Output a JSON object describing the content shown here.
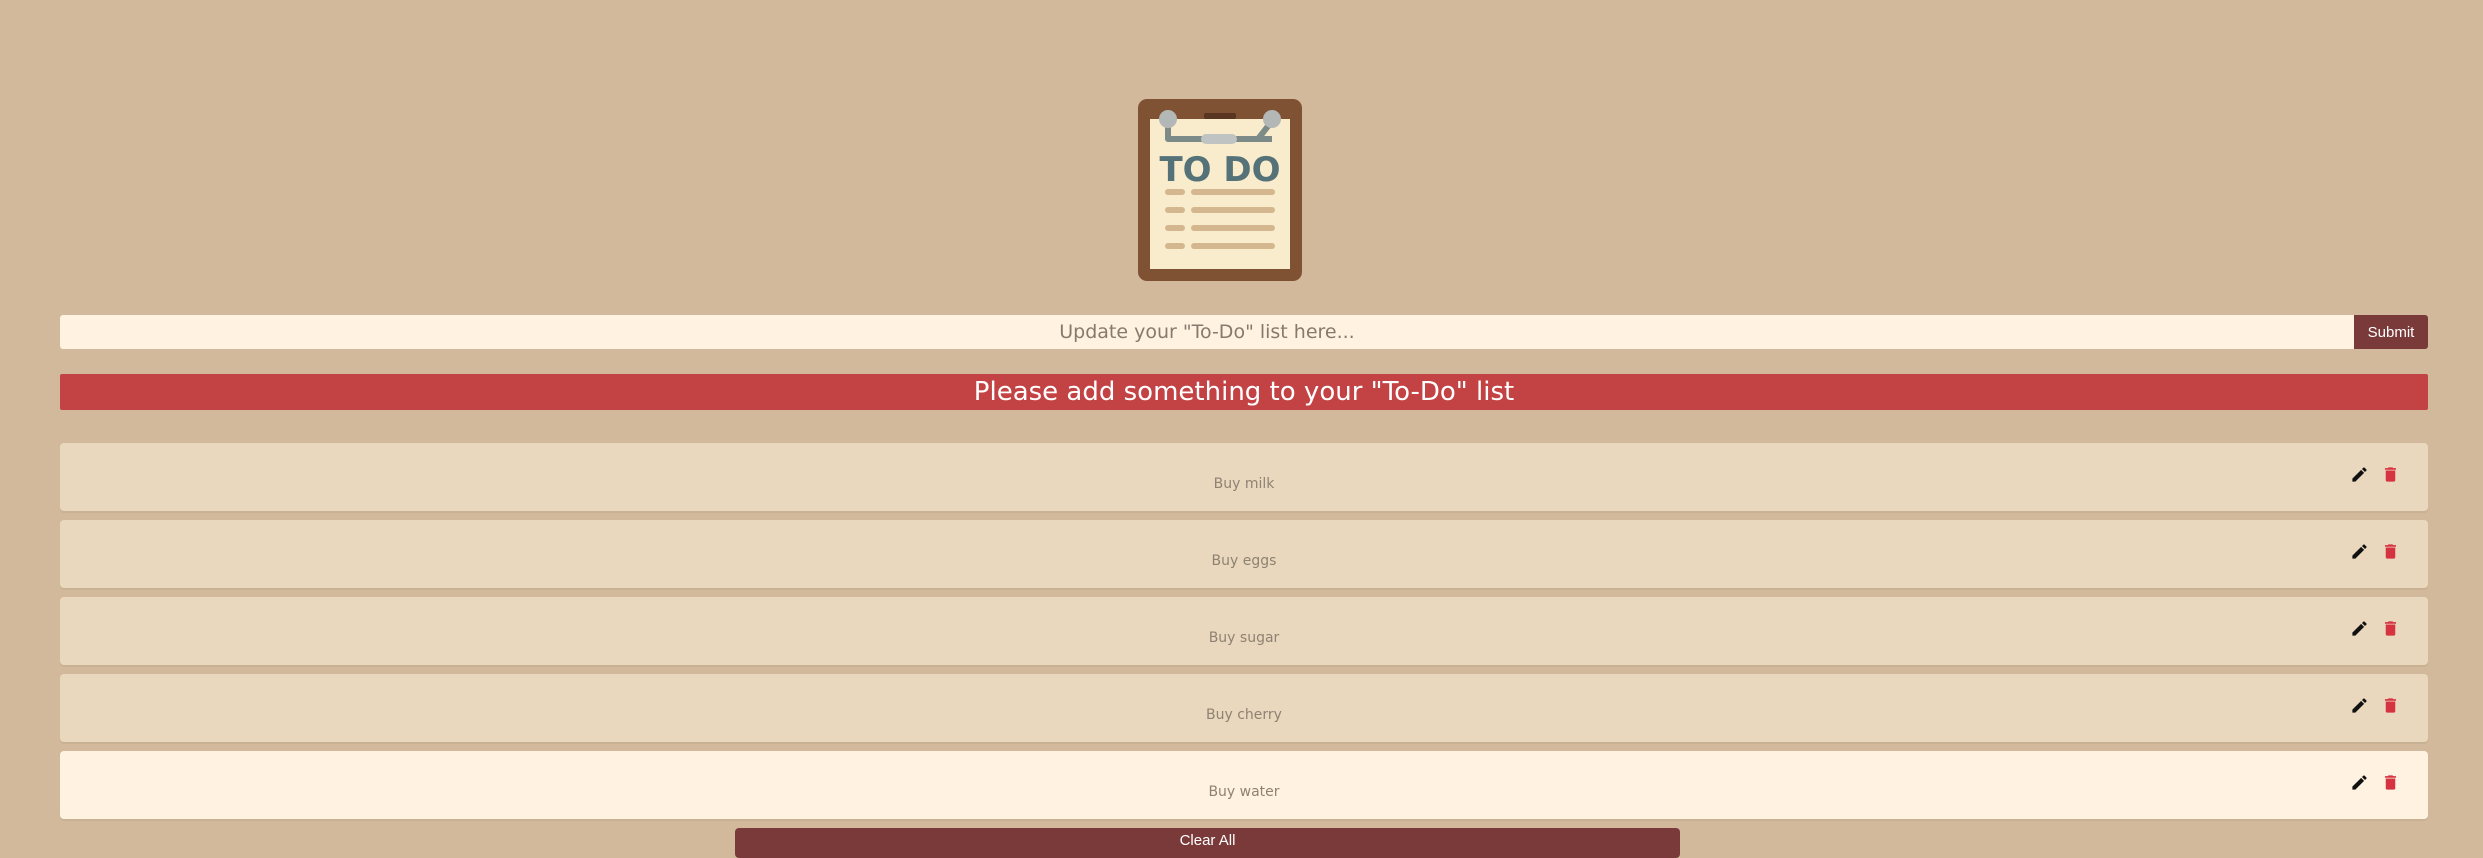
{
  "logo": {
    "icon": "todo-clipboard-icon",
    "text": "TO DO"
  },
  "form": {
    "placeholder": "Update your \"To-Do\" list here...",
    "value": "",
    "submit_label": "Submit"
  },
  "alert": {
    "message": "Please add something to your \"To-Do\" list"
  },
  "todos": [
    {
      "text": "Buy milk"
    },
    {
      "text": "Buy eggs"
    },
    {
      "text": "Buy sugar"
    },
    {
      "text": "Buy cherry"
    },
    {
      "text": "Buy water"
    }
  ],
  "icons": {
    "edit": "pencil-icon",
    "delete": "trash-icon"
  },
  "clear_all_label": "Clear All",
  "colors": {
    "background": "#d3b99c",
    "accent": "#7a3a3a",
    "alert": "#c34345",
    "item": "#e9d8be",
    "item_highlight": "#fff2e1",
    "delete_icon": "#d63340"
  }
}
